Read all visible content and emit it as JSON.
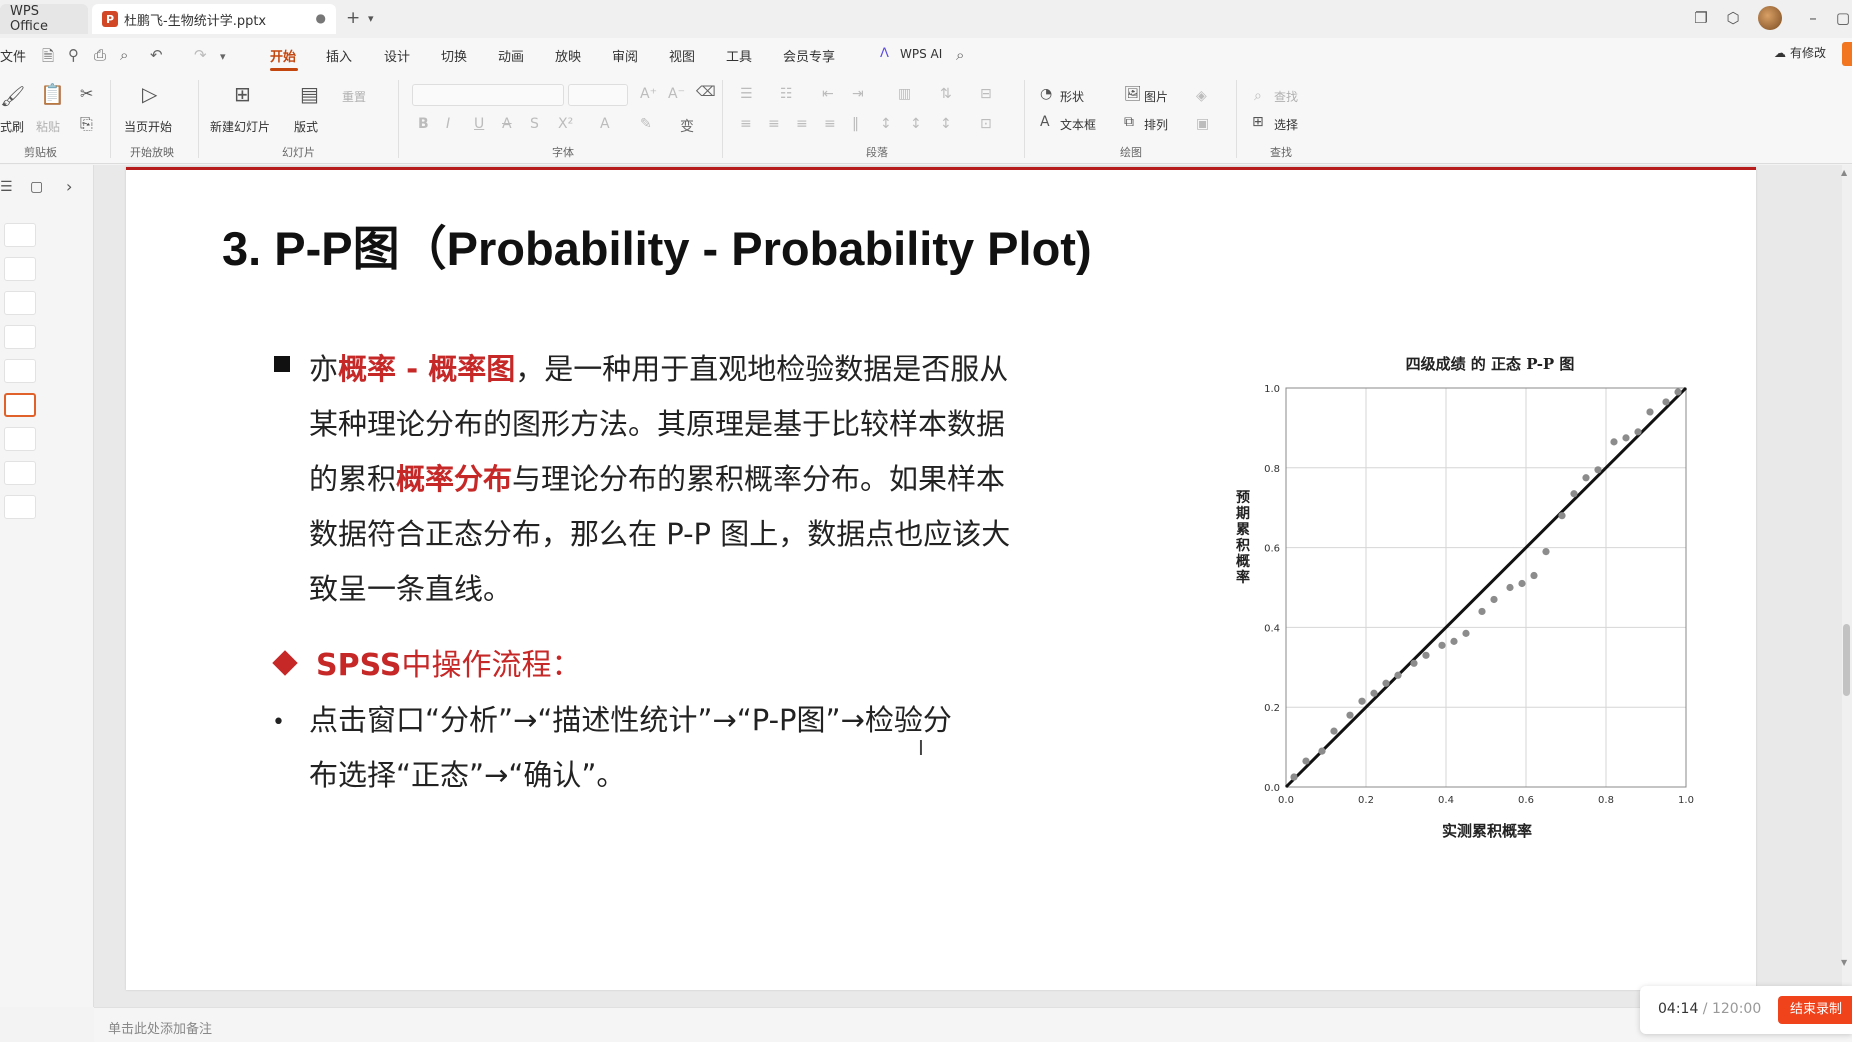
{
  "titlebar": {
    "home_tab": "WPS Office",
    "doc_tab": "杜鹏飞-生物统计学.pptx",
    "doc_badge": "P",
    "new_tab": "+",
    "close": "●"
  },
  "menubar": {
    "file": "文件",
    "tabs": [
      "开始",
      "插入",
      "设计",
      "切换",
      "动画",
      "放映",
      "审阅",
      "视图",
      "工具",
      "会员专享"
    ],
    "active_tab": "开始",
    "wps_ai": "WPS AI",
    "modify": "有修改"
  },
  "ribbon": {
    "clipboard": {
      "format_painter": "式刷",
      "paste": "粘贴",
      "group": "剪贴板"
    },
    "playback": {
      "from_current": "当页开始",
      "group": "开始放映"
    },
    "slides": {
      "new_slide": "新建幻灯片",
      "layout": "版式",
      "reset": "重置",
      "group": "幻灯片"
    },
    "font": {
      "group": "字体"
    },
    "paragraph": {
      "group": "段落"
    },
    "drawing": {
      "shape": "形状",
      "picture": "图片",
      "textbox": "文本框",
      "arrange": "排列",
      "group": "绘图"
    },
    "find": {
      "find": "查找",
      "select": "选择",
      "group": "查找"
    }
  },
  "slide": {
    "title": "3. P-P图（Probability - Probability Plot)",
    "para": {
      "p1": "亦",
      "h1": "概率 - 概率图",
      "p2": "，是一种用于直观地检验数据是否服从某种理论分布的图形方法。其原理是基于比较样本数据的累积",
      "h2": "概率分布",
      "p3": "与理论分布的累积概率分布。如果样本数据符合正态分布，那么在 P-P 图上，数据点也应该大致呈一条直线。"
    },
    "spss_heading": {
      "bold": "SPSS",
      "rest": "中操作流程："
    },
    "steps": "点击窗口“分析”→“描述性统计”→“P-P图”→检验分布选择“正态”→“确认”。"
  },
  "chart_data": {
    "type": "scatter",
    "title": "四级成绩 的 正态 P-P 图",
    "xlabel": "实测累积概率",
    "ylabel": "预期累积概率",
    "xlim": [
      0,
      1
    ],
    "ylim": [
      0,
      1
    ],
    "xticks": [
      "0.0",
      "0.2",
      "0.4",
      "0.6",
      "0.8",
      "1.0"
    ],
    "yticks": [
      "0.0",
      "0.2",
      "0.4",
      "0.6",
      "0.8",
      "1.0"
    ],
    "grid": true,
    "reference_line": {
      "from": [
        0,
        0
      ],
      "to": [
        1,
        1
      ]
    },
    "points": [
      [
        0.02,
        0.025
      ],
      [
        0.05,
        0.065
      ],
      [
        0.09,
        0.09
      ],
      [
        0.12,
        0.14
      ],
      [
        0.16,
        0.18
      ],
      [
        0.19,
        0.215
      ],
      [
        0.22,
        0.235
      ],
      [
        0.25,
        0.26
      ],
      [
        0.28,
        0.28
      ],
      [
        0.32,
        0.31
      ],
      [
        0.35,
        0.33
      ],
      [
        0.39,
        0.355
      ],
      [
        0.42,
        0.365
      ],
      [
        0.45,
        0.385
      ],
      [
        0.49,
        0.44
      ],
      [
        0.52,
        0.47
      ],
      [
        0.56,
        0.5
      ],
      [
        0.59,
        0.51
      ],
      [
        0.62,
        0.53
      ],
      [
        0.65,
        0.59
      ],
      [
        0.69,
        0.68
      ],
      [
        0.72,
        0.735
      ],
      [
        0.75,
        0.775
      ],
      [
        0.78,
        0.795
      ],
      [
        0.82,
        0.865
      ],
      [
        0.85,
        0.875
      ],
      [
        0.88,
        0.89
      ],
      [
        0.91,
        0.94
      ],
      [
        0.95,
        0.965
      ],
      [
        0.98,
        0.99
      ]
    ]
  },
  "notes": {
    "placeholder": "单击此处添加备注"
  },
  "recording": {
    "elapsed": "04:14",
    "total": " / 120:00",
    "stop": "结束录制"
  }
}
